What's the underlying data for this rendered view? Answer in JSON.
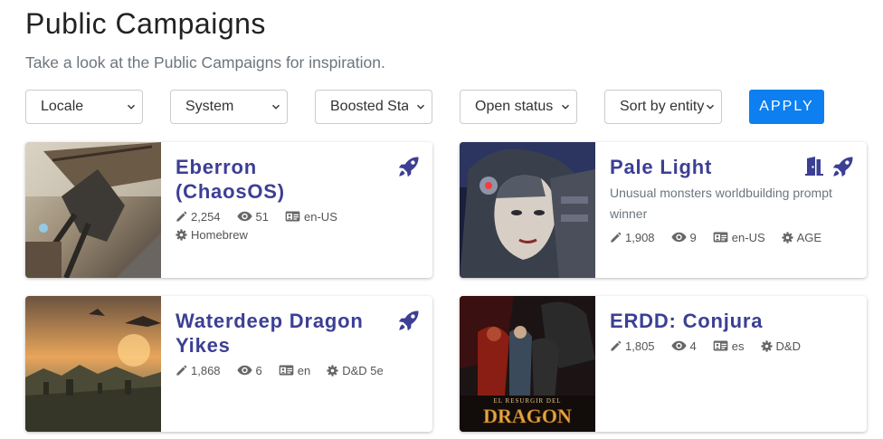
{
  "header": {
    "title": "Public Campaigns",
    "subtitle": "Take a look at the Public Campaigns for inspiration."
  },
  "filters": {
    "locale": "Locale",
    "system": "System",
    "boosted": "Boosted Status",
    "open": "Open status",
    "sort": "Sort by entity",
    "apply": "APPLY"
  },
  "colors": {
    "accent": "#0d7ff0",
    "title": "#3c3f94"
  },
  "campaigns": [
    {
      "title": "Eberron (ChaosOS)",
      "description": "",
      "entities": "2,254",
      "views": "51",
      "locale": "en-US",
      "system": "Homebrew",
      "icons": [
        "rocket-icon"
      ]
    },
    {
      "title": "Pale Light",
      "description": "Unusual monsters worldbuilding prompt winner",
      "entities": "1,908",
      "views": "9",
      "locale": "en-US",
      "system": "AGE",
      "icons": [
        "door-open-icon",
        "rocket-icon"
      ]
    },
    {
      "title": "Waterdeep Dragon Yikes",
      "description": "",
      "entities": "1,868",
      "views": "6",
      "locale": "en",
      "system": "D&D 5e",
      "icons": [
        "rocket-icon"
      ]
    },
    {
      "title": "ERDD: Conjura",
      "description": "",
      "entities": "1,805",
      "views": "4",
      "locale": "es",
      "system": "D&D",
      "icons": []
    }
  ],
  "thumb_texts": {
    "erdd_line1": "EL RESURGIR DEL",
    "erdd_line2": "DRAGON"
  }
}
